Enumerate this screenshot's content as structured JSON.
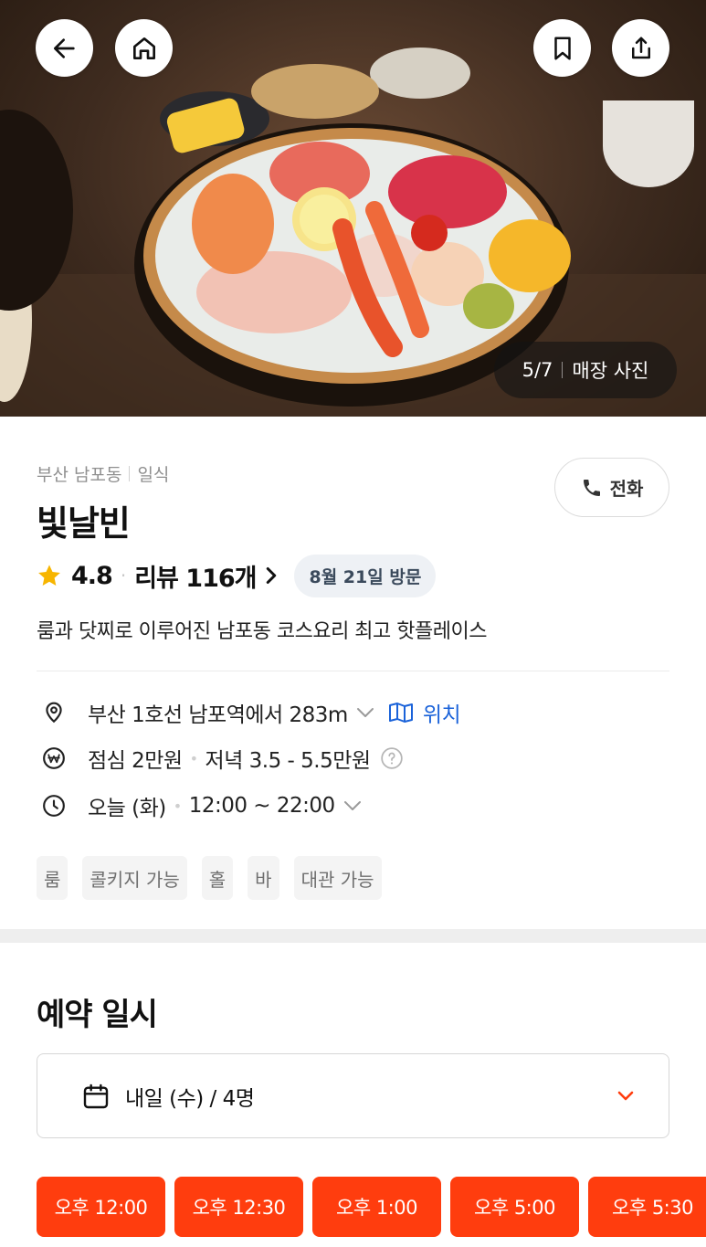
{
  "hero": {
    "photo_index": "5/7",
    "photo_label": "매장 사진",
    "buttons": [
      "back-icon",
      "home-icon",
      "bookmark-icon",
      "share-icon"
    ]
  },
  "restaurant": {
    "area": "부산 남포동",
    "category": "일식",
    "name": "빛날빈",
    "call_label": "전화",
    "rating": "4.8",
    "review_label": "리뷰 116개",
    "visit_badge": "8월 21일 방문",
    "description": "룸과 닷찌로 이루어진 남포동 코스요리 최고 핫플레이스"
  },
  "details": {
    "location": "부산 1호선 남포역에서 283m",
    "map_link": "위치",
    "price_lunch": "점심 2만원",
    "price_dinner": "저녁 3.5 - 5.5만원",
    "hours_day": "오늘 (화)",
    "hours_time": "12:00 ~ 22:00"
  },
  "tags": [
    "룸",
    "콜키지 가능",
    "홀",
    "바",
    "대관 가능"
  ],
  "reservation": {
    "title": "예약 일시",
    "selected": "내일 (수) / 4명",
    "times": [
      "오후 12:00",
      "오후 12:30",
      "오후 1:00",
      "오후 5:00",
      "오후 5:30"
    ]
  },
  "colors": {
    "accent": "#ff3d0e",
    "link": "#1a62d9",
    "star": "#f7b500"
  }
}
